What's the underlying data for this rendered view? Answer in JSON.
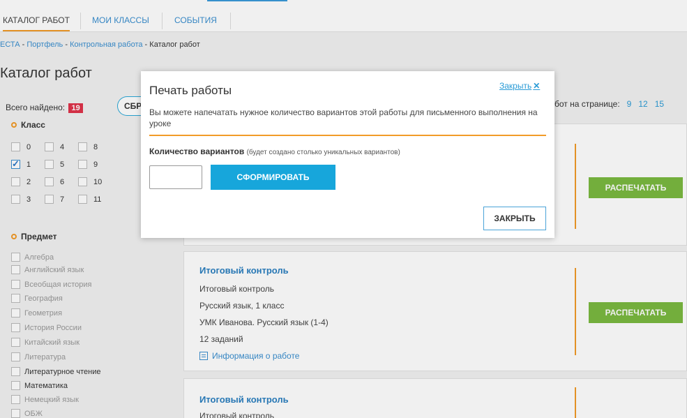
{
  "nav": {
    "tabs": [
      {
        "label": "КАТАЛОГ РАБОТ"
      },
      {
        "label": "МОИ КЛАССЫ"
      },
      {
        "label": "СОБЫТИЯ"
      }
    ]
  },
  "breadcrumb": {
    "items": [
      "ЕСТА",
      "Портфель",
      "Контрольная работа"
    ],
    "current": "Каталог работ",
    "separator": " - "
  },
  "page_title": "Каталог работ",
  "sidebar": {
    "found_label": "Всего найдено:",
    "found_count": "19",
    "reset_label": "СБР",
    "class_section": "Класс",
    "classes": [
      "0",
      "4",
      "8",
      "1",
      "5",
      "9",
      "2",
      "6",
      "10",
      "3",
      "7",
      "11"
    ],
    "checked_class": "1",
    "subject_section": "Предмет",
    "subjects": [
      "Алгебра",
      "Английский язык",
      "Всеобщая история",
      "География",
      "Геометрия",
      "История России",
      "Китайский язык",
      "Литература",
      "Литературное чтение",
      "Математика",
      "Немецкий язык",
      "ОБЖ"
    ]
  },
  "per_page": {
    "label": "бот на странице:",
    "options": [
      "9",
      "12",
      "15"
    ]
  },
  "cards": [
    {
      "title": "",
      "lines": [],
      "print_label": "РАСПЕЧАТАТЬ"
    },
    {
      "title": "Итоговый контроль",
      "lines": [
        "Итоговый контроль",
        "Русский язык, 1 класс",
        "УМК Иванова. Русский язык (1-4)",
        "12 заданий"
      ],
      "info_label": "Информация о работе",
      "print_label": "РАСПЕЧАТАТЬ"
    },
    {
      "title": "Итоговый контроль",
      "lines": [
        "Итоговый контроль"
      ]
    }
  ],
  "modal": {
    "title": "Печать работы",
    "close_link": "Закрыть",
    "close_x": "✕",
    "description": "Вы можете напечатать нужное количество вариантов этой работы для письменного выполнения на уроке",
    "count_label": "Количество вариантов",
    "count_hint": "(будет создано столько уникальных вариантов)",
    "count_value": "",
    "generate_label": "СФОРМИРОВАТЬ",
    "close_button": "ЗАКРЫТЬ"
  },
  "colors": {
    "accent_orange": "#f29b28",
    "link_blue": "#2a9bd6",
    "print_green": "#7bb940",
    "badge_red": "#e0344b"
  }
}
